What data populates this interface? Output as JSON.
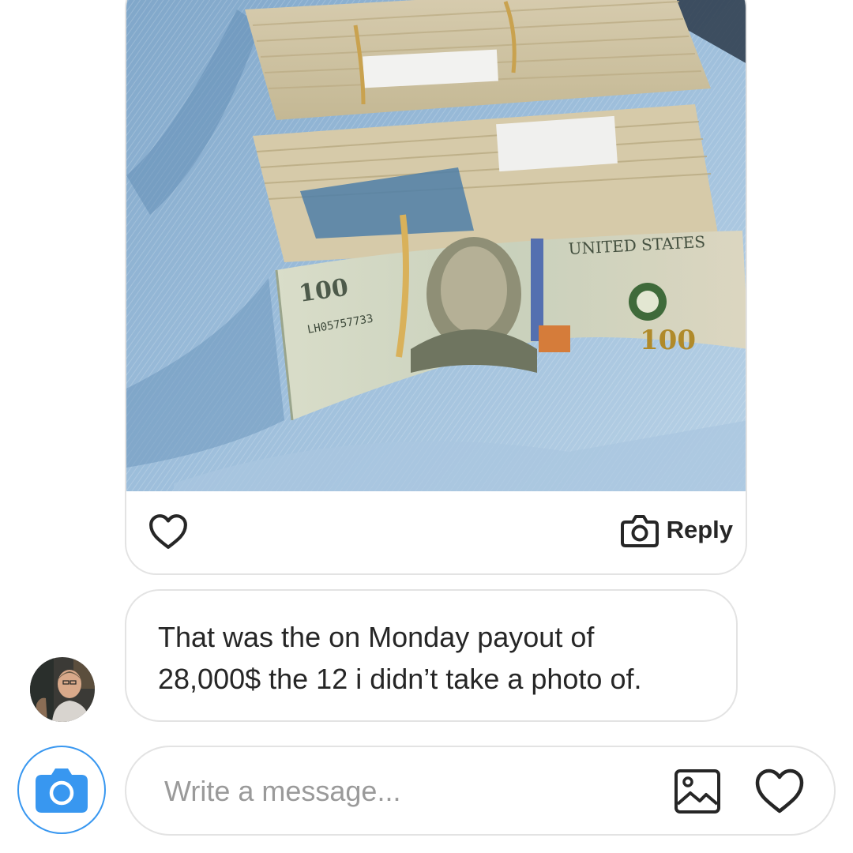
{
  "photo_message": {
    "reply_label": "Reply",
    "like_icon": "heart-outline-icon",
    "reply_icon": "camera-outline-icon"
  },
  "text_message": {
    "text": "That was the on Monday payout of\n28,000$ the 12 i didn’t take a photo of."
  },
  "composer": {
    "placeholder": "Write a message...",
    "camera_icon": "camera-icon",
    "gallery_icon": "image-gallery-icon",
    "like_icon": "heart-outline-icon"
  },
  "colors": {
    "accent": "#3897f0",
    "bubble_border": "#e3e3e3",
    "text": "#262626",
    "placeholder": "#9a9a9a"
  }
}
